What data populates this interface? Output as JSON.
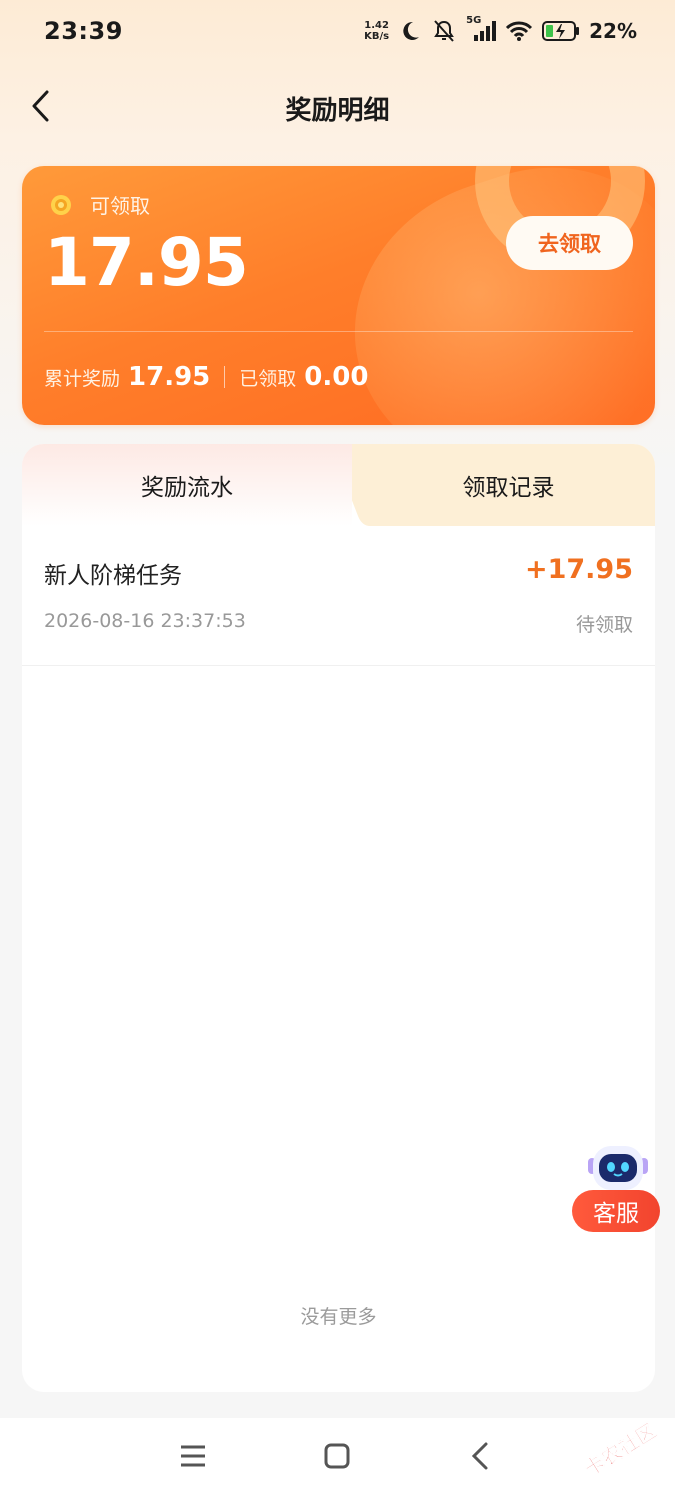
{
  "status_bar": {
    "time": "23:39",
    "net_speed_value": "1.42",
    "net_speed_unit": "KB/s",
    "network_type": "5G",
    "battery_percent": "22%",
    "icons": [
      "moon-icon",
      "bell-muted-icon",
      "signal-icon",
      "wifi-icon",
      "battery-charging-icon"
    ]
  },
  "header": {
    "title": "奖励明细",
    "back_icon": "chevron-left-icon"
  },
  "reward_card": {
    "available_label": "可领取",
    "available_amount": "17.95",
    "claim_button": "去领取",
    "total_label": "累计奖励",
    "total_value": "17.95",
    "claimed_label": "已领取",
    "claimed_value": "0.00",
    "accent_color": "#ff7e2a"
  },
  "tabs": [
    {
      "label": "奖励流水",
      "active": true
    },
    {
      "label": "领取记录",
      "active": false
    }
  ],
  "records": [
    {
      "title": "新人阶梯任务",
      "amount": "+17.95",
      "time": "2026-08-16 23:37:53",
      "status": "待领取"
    }
  ],
  "list_footer": "没有更多",
  "customer_service": {
    "label": "客服",
    "icon": "robot-icon"
  },
  "system_nav": {
    "icons": [
      "menu-icon",
      "home-square-icon",
      "back-triangle-icon"
    ]
  },
  "watermark": {
    "text": "卡农社区"
  }
}
